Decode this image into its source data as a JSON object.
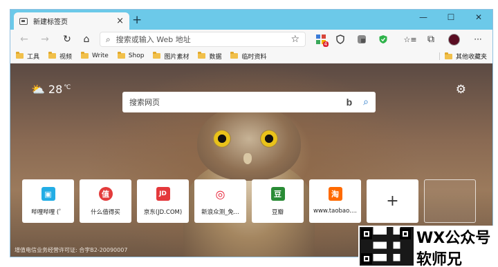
{
  "tab": {
    "title": "新建标签页",
    "close": "×",
    "new_tab": "+"
  },
  "window_controls": {
    "minimize": "—",
    "maximize": "☐",
    "close": "✕"
  },
  "toolbar": {
    "back": "←",
    "forward": "→",
    "refresh": "↻",
    "home": "⌂",
    "address_placeholder": "搜索或输入 Web 地址",
    "favorite_star": "☆",
    "reading_list": "☆≡",
    "collections": "⧉",
    "more": "···",
    "extension_badge": "4"
  },
  "bookmarks": {
    "items": [
      {
        "label": "工具"
      },
      {
        "label": "视频"
      },
      {
        "label": "Write"
      },
      {
        "label": "Shop"
      },
      {
        "label": "图片素材"
      },
      {
        "label": "数据"
      },
      {
        "label": "临时资料"
      }
    ],
    "other": "其他收藏夹"
  },
  "ntp": {
    "weather": {
      "icon": "cloud-sun-icon",
      "temp": "28",
      "unit": "℃"
    },
    "search_placeholder": "搜索网页",
    "tiles": [
      {
        "label": "哔哩哔哩 (゜",
        "icon_text": "▣",
        "color": "#23ade5"
      },
      {
        "label": "什么值得买",
        "icon_text": "值",
        "color": "#e33b3b"
      },
      {
        "label": "京东(JD.COM)",
        "icon_text": "JD",
        "color": "#e4393c"
      },
      {
        "label": "新浪众测_免...",
        "icon_text": "◎",
        "color": "#e6162d"
      },
      {
        "label": "豆瓣",
        "icon_text": "豆",
        "color": "#2a8c36"
      },
      {
        "label": "www.taobao....",
        "icon_text": "淘",
        "color": "#ff6a00"
      }
    ],
    "add_tile": "+",
    "footer": "增值电信业务经营许可证: 合字B2-20090007"
  },
  "watermark": {
    "line1": "WX公众号",
    "line2": "软师兄"
  }
}
